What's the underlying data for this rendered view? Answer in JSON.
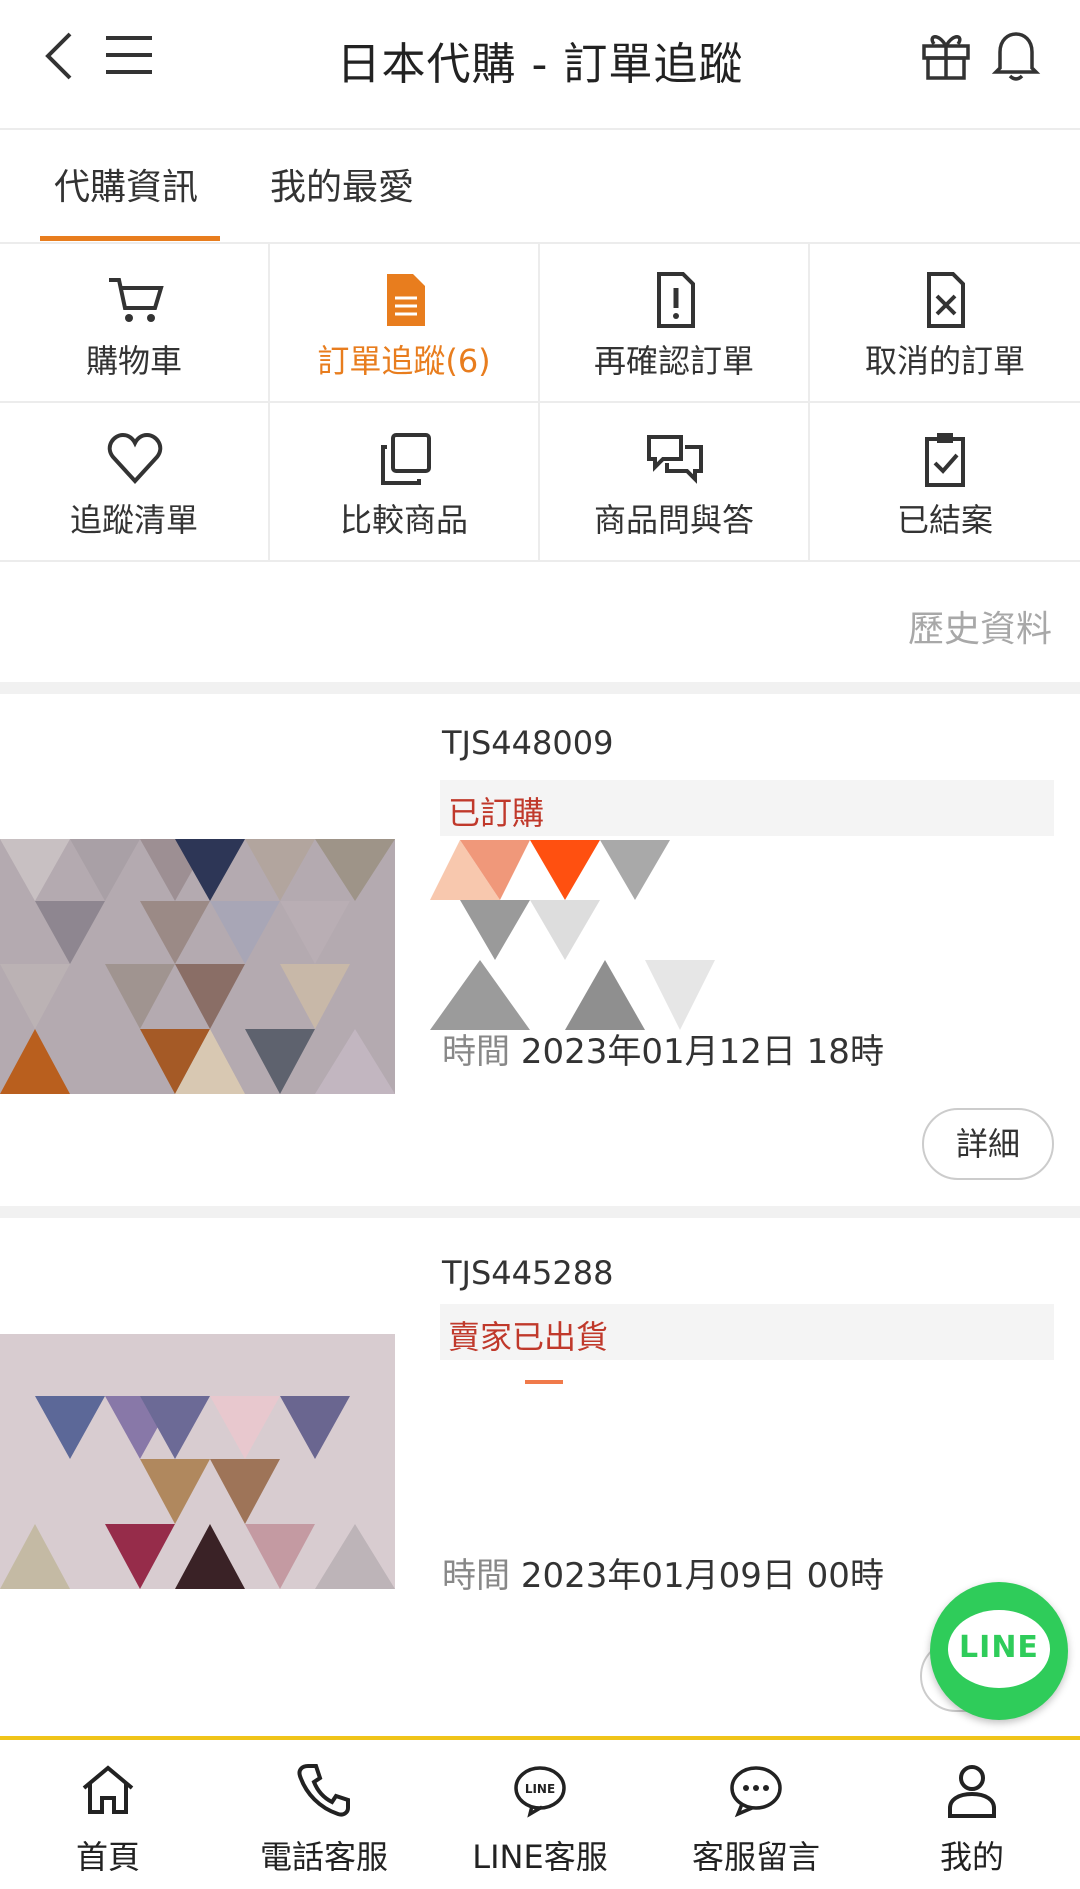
{
  "header": {
    "title": "日本代購 - 訂單追蹤",
    "icons": [
      "back-icon",
      "menu-icon",
      "gift-icon",
      "bell-icon"
    ]
  },
  "tabs": [
    {
      "label": "代購資訊",
      "active": true
    },
    {
      "label": "我的最愛",
      "active": false
    }
  ],
  "grid": [
    {
      "label": "購物車",
      "icon": "cart-icon"
    },
    {
      "label": "訂單追蹤(6)",
      "icon": "document-icon",
      "active": true
    },
    {
      "label": "再確認訂單",
      "icon": "document-alert-icon"
    },
    {
      "label": "取消的訂單",
      "icon": "document-cancel-icon"
    },
    {
      "label": "追蹤清單",
      "icon": "heart-icon"
    },
    {
      "label": "比較商品",
      "icon": "copy-icon"
    },
    {
      "label": "商品問與答",
      "icon": "chat-icon"
    },
    {
      "label": "已結案",
      "icon": "clipboard-check-icon"
    }
  ],
  "history_link": "歷史資料",
  "orders": [
    {
      "order_no": "TJS448009",
      "status": "已訂購",
      "time_label": "時間",
      "time_value": "2023年01月12日 18時",
      "detail_label": "詳細"
    },
    {
      "order_no": "TJS445288",
      "status": "賣家已出貨",
      "time_label": "時間",
      "time_value": "2023年01月09日 00時",
      "detail_label": "詳細"
    }
  ],
  "line_fab": {
    "label": "LINE"
  },
  "bottom_nav": [
    {
      "label": "首頁",
      "icon": "home-icon"
    },
    {
      "label": "電話客服",
      "icon": "phone-icon"
    },
    {
      "label": "LINE客服",
      "icon": "line-icon"
    },
    {
      "label": "客服留言",
      "icon": "message-icon"
    },
    {
      "label": "我的",
      "icon": "user-icon"
    }
  ],
  "colors": {
    "accent": "#e87d1e",
    "status": "#c0392b",
    "line_green": "#2fcc5a",
    "nav_border": "#f0c419"
  }
}
